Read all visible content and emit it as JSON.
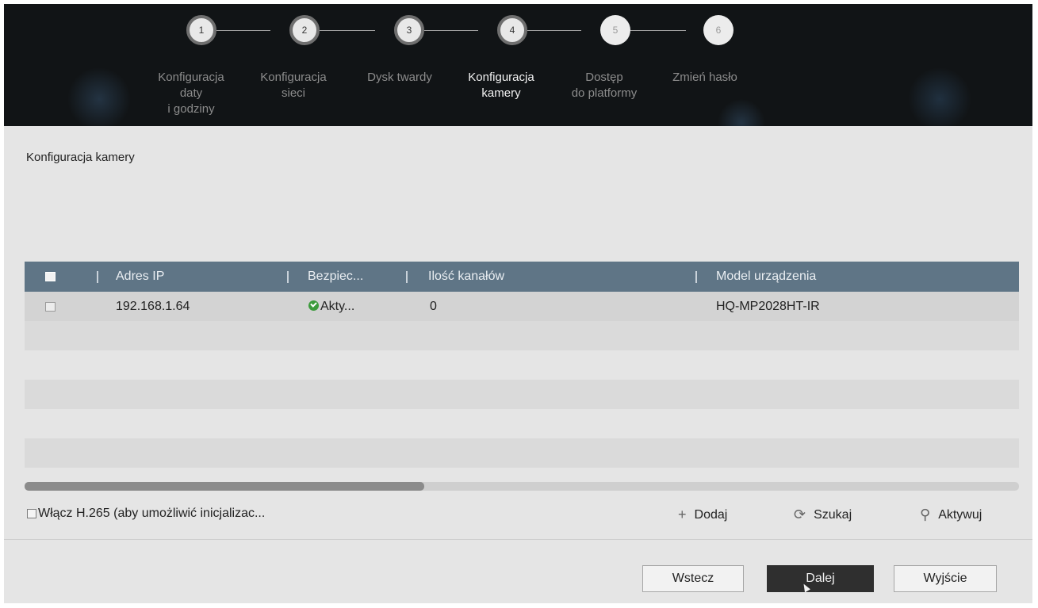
{
  "wizard": {
    "steps": [
      {
        "number": "1",
        "label_lines": [
          "Konfiguracja",
          "daty",
          "i godziny"
        ],
        "state": "done"
      },
      {
        "number": "2",
        "label_lines": [
          "Konfiguracja",
          "sieci"
        ],
        "state": "done"
      },
      {
        "number": "3",
        "label_lines": [
          "Dysk twardy"
        ],
        "state": "done"
      },
      {
        "number": "4",
        "label_lines": [
          "Konfiguracja",
          "kamery"
        ],
        "state": "active"
      },
      {
        "number": "5",
        "label_lines": [
          "Dostęp",
          "do platformy"
        ],
        "state": "todo"
      },
      {
        "number": "6",
        "label_lines": [
          "Zmień hasło"
        ],
        "state": "todo"
      }
    ]
  },
  "section": {
    "title": "Konfiguracja kamery"
  },
  "table": {
    "columns": [
      "Adres IP",
      "Bezpiec...",
      "Ilość kanałów",
      "Model urządzenia"
    ],
    "rows": [
      {
        "ip": "192.168.1.64",
        "security": "Akty...",
        "channels": "0",
        "model": "HQ-MP2028HT-IR"
      }
    ]
  },
  "options": {
    "h265_label": "Włącz H.265 (aby umożliwić inicjalizac..."
  },
  "tools": {
    "add": "Dodaj",
    "search": "Szukaj",
    "activate": "Aktywuj"
  },
  "buttons": {
    "back": "Wstecz",
    "next": "Dalej",
    "exit": "Wyjście"
  },
  "colors": {
    "header_bg": "#111416",
    "table_header": "#5f7586",
    "status_ok": "#3c9b3c",
    "primary_button": "#2f2f2f"
  }
}
